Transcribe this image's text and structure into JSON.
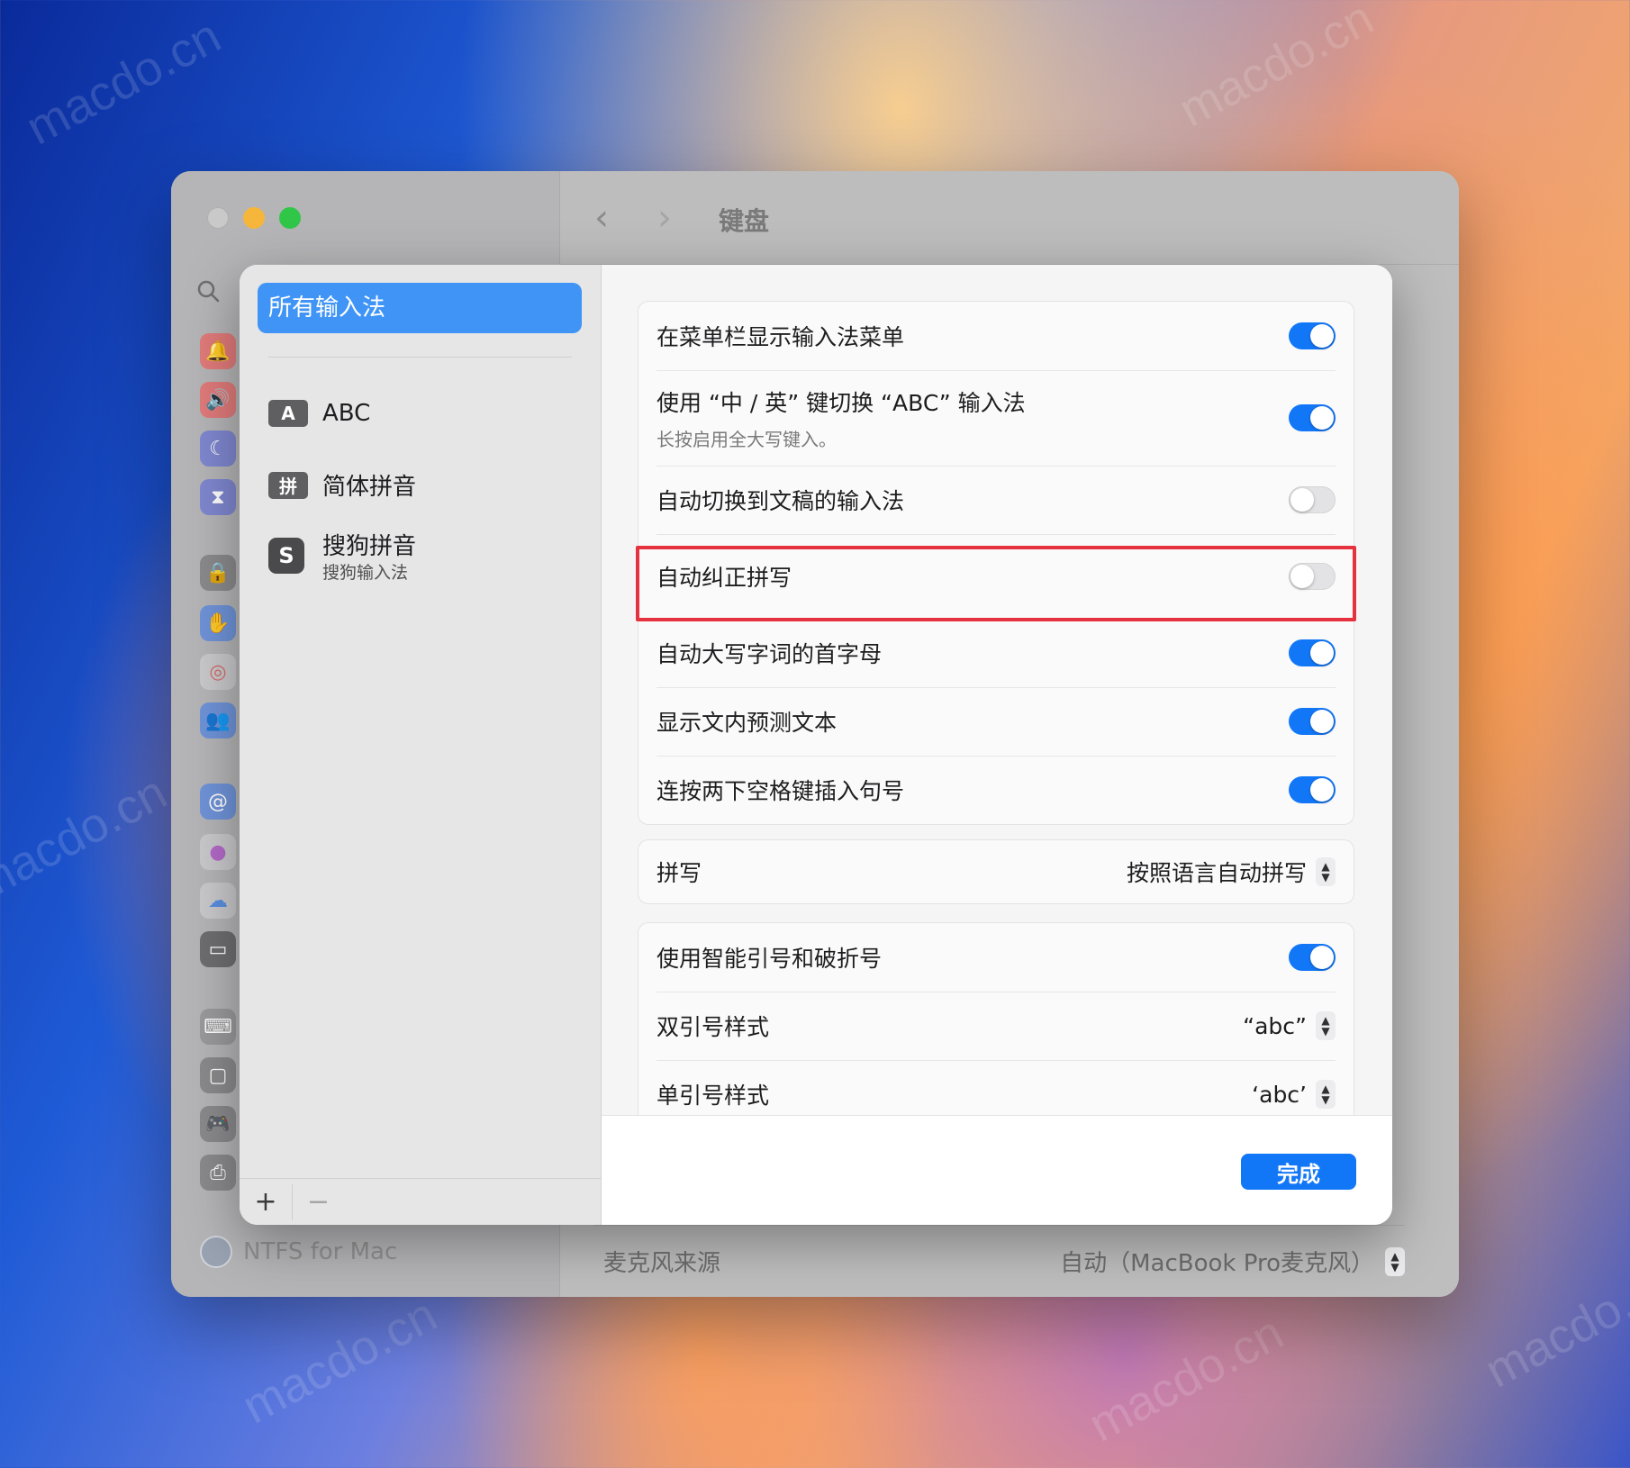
{
  "watermark": "macdo.cn",
  "window": {
    "title": "键盘",
    "sidebar_footer_app": "NTFS for Mac",
    "mic_source_label": "麦克风来源",
    "mic_source_value": "自动（MacBook Pro麦克风）"
  },
  "sheet": {
    "sidebar": {
      "selected": "所有输入法",
      "items": [
        {
          "badge": "A",
          "label": "ABC",
          "sub": ""
        },
        {
          "badge": "拼",
          "label": "简体拼音",
          "sub": ""
        },
        {
          "badge": "S",
          "label": "搜狗拼音",
          "sub": "搜狗输入法"
        }
      ],
      "add_label": "+",
      "remove_label": "−"
    },
    "settings": {
      "group1": [
        {
          "label": "在菜单栏显示输入法菜单",
          "sub": "",
          "on": true
        },
        {
          "label": "使用 “中 / 英” 键切换 “ABC” 输入法",
          "sub": "长按启用全大写键入。",
          "on": true
        },
        {
          "label": "自动切换到文稿的输入法",
          "sub": "",
          "on": false
        },
        {
          "label": "自动纠正拼写",
          "sub": "",
          "on": false
        },
        {
          "label": "自动大写字词的首字母",
          "sub": "",
          "on": true
        },
        {
          "label": "显示文内预测文本",
          "sub": "",
          "on": true
        },
        {
          "label": "连按两下空格键插入句号",
          "sub": "",
          "on": true
        }
      ],
      "spelling": {
        "label": "拼写",
        "value": "按照语言自动拼写"
      },
      "group3": {
        "smart_quotes": {
          "label": "使用智能引号和破折号",
          "on": true
        },
        "double_quote": {
          "label": "双引号样式",
          "value": "“abc”"
        },
        "single_quote": {
          "label": "单引号样式",
          "value": "‘abc’"
        }
      }
    },
    "done_label": "完成"
  },
  "colors": {
    "accent": "#1277f7",
    "highlight_border": "#e5323e",
    "selected_sidebar": "#3f94f6"
  },
  "icons": [
    "search-icon",
    "bell-icon",
    "speaker-icon",
    "moon-icon",
    "hourglass-icon",
    "lock-icon",
    "hand-icon",
    "fingerprint-icon",
    "users-icon",
    "at-icon",
    "game-center-icon",
    "icloud-icon",
    "wallet-icon",
    "keyboard-icon",
    "trackpad-icon",
    "gamepad-icon",
    "printer-icon"
  ]
}
